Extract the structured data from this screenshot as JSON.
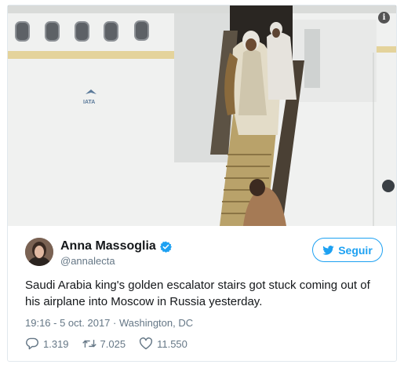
{
  "media": {
    "info_icon": "info-icon",
    "tail_logo_text": "IATA"
  },
  "author": {
    "name": "Anna Massoglia",
    "handle": "@annalecta",
    "verified": true,
    "verified_color": "#1da1f2"
  },
  "follow": {
    "label": "Seguir",
    "icon": "twitter-bird-icon",
    "color": "#1da1f2"
  },
  "tweet": {
    "text": "Saudi Arabia king's golden escalator stairs got stuck coming out of his airplane into Moscow in Russia yesterday.",
    "meta": "19:16 - 5 oct. 2017 · Washington, DC"
  },
  "stats": {
    "replies": "1.319",
    "retweets": "7.025",
    "likes": "11.550"
  }
}
